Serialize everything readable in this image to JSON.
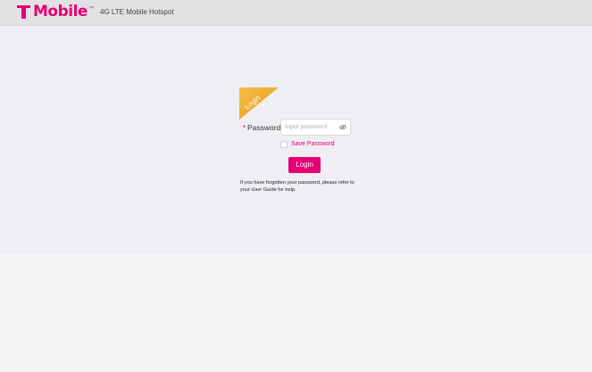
{
  "header": {
    "brand_name": "Mobile",
    "brand_mark": "T",
    "trademark": "™",
    "product_name": "4G LTE Mobile Hotspot"
  },
  "login_form": {
    "corner_ribbon_label": "Login",
    "required_marker": "*",
    "password_label": "Password",
    "password_placeholder": "Input password",
    "password_value": "",
    "show_password_icon": "eye-icon",
    "save_password_label": "Save Password",
    "save_password_checked": false,
    "login_button_label": "Login",
    "help_text": "If you have forgotten your password, please refer to your User Guide for help."
  },
  "colors": {
    "brand_magenta": "#e20074",
    "ribbon_orange": "#f0a020",
    "header_bg": "#e3e1e3",
    "page_bg": "#efeff3"
  }
}
